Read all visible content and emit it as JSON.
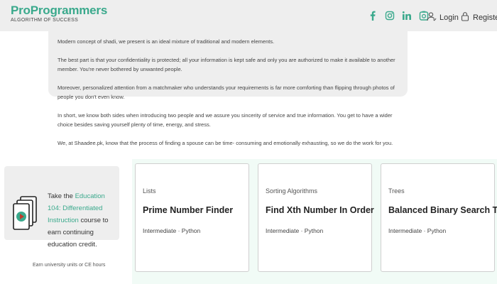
{
  "header": {
    "logo_title": "ProProgrammers",
    "logo_tagline": "ALGORITHM OF SUCCESS",
    "social_icons": [
      "facebook-icon",
      "instagram-icon",
      "linkedin-icon",
      "camera-icon"
    ],
    "login_label": "Login",
    "register_label": "Register"
  },
  "article": {
    "paragraphs": [
      "Modern concept of shadi, we present is an ideal mixture of traditional and modern elements.",
      "The best part is that your confidentiality is protected; all your information is kept safe and only you are authorized to make it available to another member. You're never bothered by unwanted people.",
      "Moreover, personalized attention from a matchmaker who understands your requirements is far more comforting than flipping through photos of people you don't even know.",
      "In short, we know both sides when introducing two people and we assure you sincerity of service and true information. You get to have a wider choice besides saving yourself plenty of time, energy, and stress.",
      "We, at Shaadee.pk, know that the process of finding a spouse can be time- consuming and emotionally exhausting, so we do the work for you."
    ]
  },
  "promo": {
    "text_before": "Take the",
    "link_text": "Education 104: Differentiated Instruction",
    "text_after": "course to earn continuing education credit.",
    "footer": "Earn university units or CE hours"
  },
  "cards": [
    {
      "category": "Lists",
      "title": "Prime Number Finder",
      "meta": "Intermediate · Python"
    },
    {
      "category": "Sorting Algorithms",
      "title": "Find Xth Number In Order",
      "meta": "Intermediate · Python"
    },
    {
      "category": "Trees",
      "title": "Balanced Binary Search Tree",
      "meta": "Intermediate · Python"
    }
  ],
  "colors": {
    "brand": "#3aa98c",
    "header_bg": "#eeeeee",
    "card_area_bg": "#f1fbf6"
  }
}
